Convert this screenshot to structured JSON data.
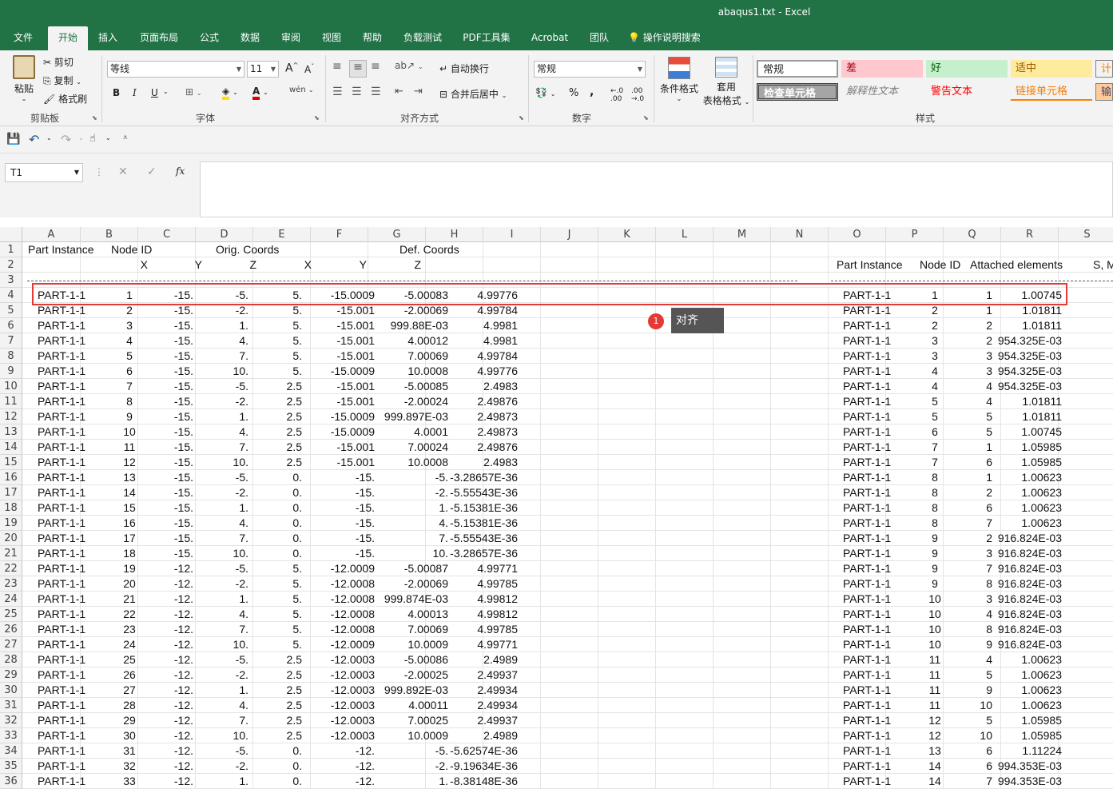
{
  "window": {
    "title": "abaqus1.txt  -  Excel"
  },
  "tabs": [
    "文件",
    "开始",
    "插入",
    "页面布局",
    "公式",
    "数据",
    "审阅",
    "视图",
    "帮助",
    "负载测试",
    "PDF工具集",
    "Acrobat",
    "团队",
    "操作说明搜索"
  ],
  "ribbon": {
    "clipboard": {
      "paste": "粘贴",
      "cut": "剪切",
      "copy": "复制",
      "format_painter": "格式刷",
      "label": "剪贴板"
    },
    "font": {
      "name": "等线",
      "size": "11",
      "label": "字体",
      "bold": "B",
      "italic": "I",
      "underline": "U",
      "grow": "A",
      "shrink": "A"
    },
    "align": {
      "wrap": "自动换行",
      "merge": "合并后居中",
      "label": "对齐方式"
    },
    "number": {
      "format": "常规",
      "percent": "%",
      "comma": ",",
      "label": "数字"
    },
    "cond": {
      "label": "条件格式"
    },
    "table": {
      "label1": "套用",
      "label2": "表格格式"
    },
    "styles": {
      "label": "样式",
      "normal": "常规",
      "bad": "差",
      "good": "好",
      "neutral": "适中",
      "calc": "计算",
      "check": "检查单元格",
      "explain": "解释性文本",
      "warn": "警告文本",
      "linked": "链接单元格",
      "input": "输入"
    }
  },
  "namebox": "T1",
  "fx": "fx",
  "columns": [
    "A",
    "B",
    "C",
    "D",
    "E",
    "F",
    "G",
    "H",
    "I",
    "J",
    "K",
    "L",
    "M",
    "N",
    "O",
    "P",
    "Q",
    "R",
    "S"
  ],
  "rows": [
    "1",
    "2",
    "3",
    "4",
    "5",
    "6",
    "7",
    "8",
    "9",
    "10",
    "11",
    "12",
    "13",
    "14",
    "15",
    "16",
    "17",
    "18",
    "19",
    "20",
    "21",
    "22",
    "23",
    "24",
    "25",
    "26",
    "27",
    "28",
    "29",
    "30",
    "31",
    "32",
    "33",
    "34",
    "35",
    "36"
  ],
  "header1": {
    "a": "Part Instance",
    "b": "Node ID",
    "d": "Orig. Coords",
    "g": "Def. Coords"
  },
  "header2": {
    "c": "X",
    "d": "Y",
    "e": "Z",
    "f": "X",
    "g": "Y",
    "h": "Z",
    "o": "Part Instance",
    "p": "Node ID",
    "q": "Attached elements",
    "s": "S, M"
  },
  "left_rows": [
    [
      "PART-1-1",
      "1",
      "-15.",
      "-5.",
      "5.",
      "-15.0009",
      "-5.00083",
      "4.99776"
    ],
    [
      "PART-1-1",
      "2",
      "-15.",
      "-2.",
      "5.",
      "-15.001",
      "-2.00069",
      "4.99784"
    ],
    [
      "PART-1-1",
      "3",
      "-15.",
      "1.",
      "5.",
      "-15.001",
      "999.88E-03",
      "4.9981"
    ],
    [
      "PART-1-1",
      "4",
      "-15.",
      "4.",
      "5.",
      "-15.001",
      "4.00012",
      "4.9981"
    ],
    [
      "PART-1-1",
      "5",
      "-15.",
      "7.",
      "5.",
      "-15.001",
      "7.00069",
      "4.99784"
    ],
    [
      "PART-1-1",
      "6",
      "-15.",
      "10.",
      "5.",
      "-15.0009",
      "10.0008",
      "4.99776"
    ],
    [
      "PART-1-1",
      "7",
      "-15.",
      "-5.",
      "2.5",
      "-15.001",
      "-5.00085",
      "2.4983"
    ],
    [
      "PART-1-1",
      "8",
      "-15.",
      "-2.",
      "2.5",
      "-15.001",
      "-2.00024",
      "2.49876"
    ],
    [
      "PART-1-1",
      "9",
      "-15.",
      "1.",
      "2.5",
      "-15.0009",
      "999.897E-03",
      "2.49873"
    ],
    [
      "PART-1-1",
      "10",
      "-15.",
      "4.",
      "2.5",
      "-15.0009",
      "4.0001",
      "2.49873"
    ],
    [
      "PART-1-1",
      "11",
      "-15.",
      "7.",
      "2.5",
      "-15.001",
      "7.00024",
      "2.49876"
    ],
    [
      "PART-1-1",
      "12",
      "-15.",
      "10.",
      "2.5",
      "-15.001",
      "10.0008",
      "2.4983"
    ],
    [
      "PART-1-1",
      "13",
      "-15.",
      "-5.",
      "0.",
      "-15.",
      "-5.",
      "-3.28657E-36"
    ],
    [
      "PART-1-1",
      "14",
      "-15.",
      "-2.",
      "0.",
      "-15.",
      "-2.",
      "-5.55543E-36"
    ],
    [
      "PART-1-1",
      "15",
      "-15.",
      "1.",
      "0.",
      "-15.",
      "1.",
      "-5.15381E-36"
    ],
    [
      "PART-1-1",
      "16",
      "-15.",
      "4.",
      "0.",
      "-15.",
      "4.",
      "-5.15381E-36"
    ],
    [
      "PART-1-1",
      "17",
      "-15.",
      "7.",
      "0.",
      "-15.",
      "7.",
      "-5.55543E-36"
    ],
    [
      "PART-1-1",
      "18",
      "-15.",
      "10.",
      "0.",
      "-15.",
      "10.",
      "-3.28657E-36"
    ],
    [
      "PART-1-1",
      "19",
      "-12.",
      "-5.",
      "5.",
      "-12.0009",
      "-5.00087",
      "4.99771"
    ],
    [
      "PART-1-1",
      "20",
      "-12.",
      "-2.",
      "5.",
      "-12.0008",
      "-2.00069",
      "4.99785"
    ],
    [
      "PART-1-1",
      "21",
      "-12.",
      "1.",
      "5.",
      "-12.0008",
      "999.874E-03",
      "4.99812"
    ],
    [
      "PART-1-1",
      "22",
      "-12.",
      "4.",
      "5.",
      "-12.0008",
      "4.00013",
      "4.99812"
    ],
    [
      "PART-1-1",
      "23",
      "-12.",
      "7.",
      "5.",
      "-12.0008",
      "7.00069",
      "4.99785"
    ],
    [
      "PART-1-1",
      "24",
      "-12.",
      "10.",
      "5.",
      "-12.0009",
      "10.0009",
      "4.99771"
    ],
    [
      "PART-1-1",
      "25",
      "-12.",
      "-5.",
      "2.5",
      "-12.0003",
      "-5.00086",
      "2.4989"
    ],
    [
      "PART-1-1",
      "26",
      "-12.",
      "-2.",
      "2.5",
      "-12.0003",
      "-2.00025",
      "2.49937"
    ],
    [
      "PART-1-1",
      "27",
      "-12.",
      "1.",
      "2.5",
      "-12.0003",
      "999.892E-03",
      "2.49934"
    ],
    [
      "PART-1-1",
      "28",
      "-12.",
      "4.",
      "2.5",
      "-12.0003",
      "4.00011",
      "2.49934"
    ],
    [
      "PART-1-1",
      "29",
      "-12.",
      "7.",
      "2.5",
      "-12.0003",
      "7.00025",
      "2.49937"
    ],
    [
      "PART-1-1",
      "30",
      "-12.",
      "10.",
      "2.5",
      "-12.0003",
      "10.0009",
      "2.4989"
    ],
    [
      "PART-1-1",
      "31",
      "-12.",
      "-5.",
      "0.",
      "-12.",
      "-5.",
      "-5.62574E-36"
    ],
    [
      "PART-1-1",
      "32",
      "-12.",
      "-2.",
      "0.",
      "-12.",
      "-2.",
      "-9.19634E-36"
    ],
    [
      "PART-1-1",
      "33",
      "-12.",
      "1.",
      "0.",
      "-12.",
      "1.",
      "-8.38148E-36"
    ]
  ],
  "right_rows": [
    [
      "PART-1-1",
      "1",
      "1",
      "1.00745"
    ],
    [
      "PART-1-1",
      "2",
      "1",
      "1.01811"
    ],
    [
      "PART-1-1",
      "2",
      "2",
      "1.01811"
    ],
    [
      "PART-1-1",
      "3",
      "2",
      "954.325E-03"
    ],
    [
      "PART-1-1",
      "3",
      "3",
      "954.325E-03"
    ],
    [
      "PART-1-1",
      "4",
      "3",
      "954.325E-03"
    ],
    [
      "PART-1-1",
      "4",
      "4",
      "954.325E-03"
    ],
    [
      "PART-1-1",
      "5",
      "4",
      "1.01811"
    ],
    [
      "PART-1-1",
      "5",
      "5",
      "1.01811"
    ],
    [
      "PART-1-1",
      "6",
      "5",
      "1.00745"
    ],
    [
      "PART-1-1",
      "7",
      "1",
      "1.05985"
    ],
    [
      "PART-1-1",
      "7",
      "6",
      "1.05985"
    ],
    [
      "PART-1-1",
      "8",
      "1",
      "1.00623"
    ],
    [
      "PART-1-1",
      "8",
      "2",
      "1.00623"
    ],
    [
      "PART-1-1",
      "8",
      "6",
      "1.00623"
    ],
    [
      "PART-1-1",
      "8",
      "7",
      "1.00623"
    ],
    [
      "PART-1-1",
      "9",
      "2",
      "916.824E-03"
    ],
    [
      "PART-1-1",
      "9",
      "3",
      "916.824E-03"
    ],
    [
      "PART-1-1",
      "9",
      "7",
      "916.824E-03"
    ],
    [
      "PART-1-1",
      "9",
      "8",
      "916.824E-03"
    ],
    [
      "PART-1-1",
      "10",
      "3",
      "916.824E-03"
    ],
    [
      "PART-1-1",
      "10",
      "4",
      "916.824E-03"
    ],
    [
      "PART-1-1",
      "10",
      "8",
      "916.824E-03"
    ],
    [
      "PART-1-1",
      "10",
      "9",
      "916.824E-03"
    ],
    [
      "PART-1-1",
      "11",
      "4",
      "1.00623"
    ],
    [
      "PART-1-1",
      "11",
      "5",
      "1.00623"
    ],
    [
      "PART-1-1",
      "11",
      "9",
      "1.00623"
    ],
    [
      "PART-1-1",
      "11",
      "10",
      "1.00623"
    ],
    [
      "PART-1-1",
      "12",
      "5",
      "1.05985"
    ],
    [
      "PART-1-1",
      "12",
      "10",
      "1.05985"
    ],
    [
      "PART-1-1",
      "13",
      "6",
      "1.11224"
    ],
    [
      "PART-1-1",
      "14",
      "6",
      "994.353E-03"
    ],
    [
      "PART-1-1",
      "14",
      "7",
      "994.353E-03"
    ]
  ],
  "annotation": {
    "badge": "1",
    "tooltip": "对齐"
  }
}
